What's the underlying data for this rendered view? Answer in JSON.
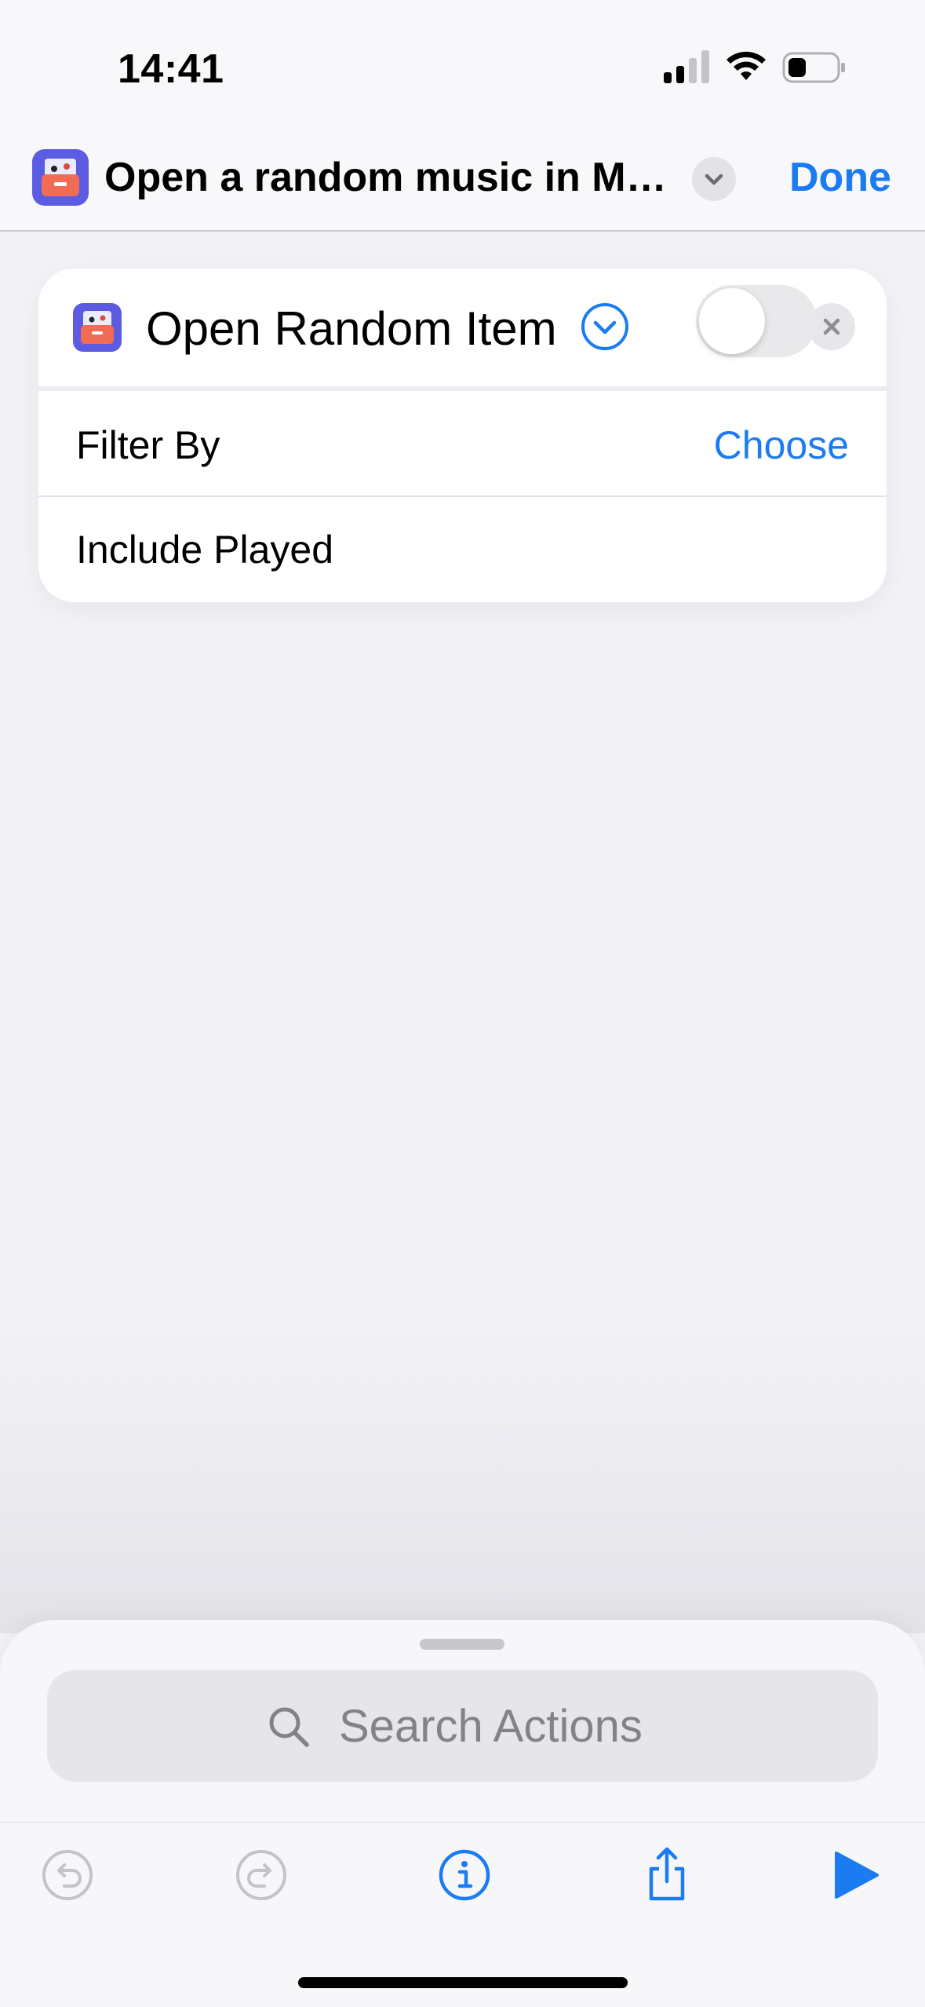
{
  "status_bar": {
    "time": "14:41"
  },
  "nav": {
    "title": "Open a random music in Mu…",
    "done_label": "Done"
  },
  "action_card": {
    "title": "Open Random Item",
    "rows": [
      {
        "label": "Filter By",
        "value": "Choose"
      },
      {
        "label": "Include Played",
        "toggle_on": false
      }
    ]
  },
  "search": {
    "placeholder": "Search Actions"
  },
  "colors": {
    "accent": "#1b7cf2",
    "background": "#f2f2f7",
    "icon_purple": "#5b5ce2",
    "icon_orange": "#f26b55"
  },
  "toolbar": {
    "icons": [
      "undo-icon",
      "redo-icon",
      "info-icon",
      "share-icon",
      "play-icon"
    ]
  }
}
